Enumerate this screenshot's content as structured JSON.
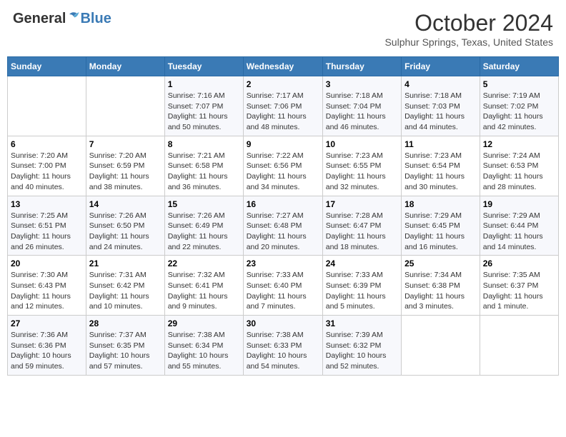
{
  "header": {
    "logo": {
      "general": "General",
      "blue": "Blue"
    },
    "title": "October 2024",
    "location": "Sulphur Springs, Texas, United States"
  },
  "weekdays": [
    "Sunday",
    "Monday",
    "Tuesday",
    "Wednesday",
    "Thursday",
    "Friday",
    "Saturday"
  ],
  "weeks": [
    [
      {
        "day": "",
        "empty": true
      },
      {
        "day": "",
        "empty": true
      },
      {
        "day": "1",
        "sunrise": "Sunrise: 7:16 AM",
        "sunset": "Sunset: 7:07 PM",
        "daylight": "Daylight: 11 hours and 50 minutes."
      },
      {
        "day": "2",
        "sunrise": "Sunrise: 7:17 AM",
        "sunset": "Sunset: 7:06 PM",
        "daylight": "Daylight: 11 hours and 48 minutes."
      },
      {
        "day": "3",
        "sunrise": "Sunrise: 7:18 AM",
        "sunset": "Sunset: 7:04 PM",
        "daylight": "Daylight: 11 hours and 46 minutes."
      },
      {
        "day": "4",
        "sunrise": "Sunrise: 7:18 AM",
        "sunset": "Sunset: 7:03 PM",
        "daylight": "Daylight: 11 hours and 44 minutes."
      },
      {
        "day": "5",
        "sunrise": "Sunrise: 7:19 AM",
        "sunset": "Sunset: 7:02 PM",
        "daylight": "Daylight: 11 hours and 42 minutes."
      }
    ],
    [
      {
        "day": "6",
        "sunrise": "Sunrise: 7:20 AM",
        "sunset": "Sunset: 7:00 PM",
        "daylight": "Daylight: 11 hours and 40 minutes."
      },
      {
        "day": "7",
        "sunrise": "Sunrise: 7:20 AM",
        "sunset": "Sunset: 6:59 PM",
        "daylight": "Daylight: 11 hours and 38 minutes."
      },
      {
        "day": "8",
        "sunrise": "Sunrise: 7:21 AM",
        "sunset": "Sunset: 6:58 PM",
        "daylight": "Daylight: 11 hours and 36 minutes."
      },
      {
        "day": "9",
        "sunrise": "Sunrise: 7:22 AM",
        "sunset": "Sunset: 6:56 PM",
        "daylight": "Daylight: 11 hours and 34 minutes."
      },
      {
        "day": "10",
        "sunrise": "Sunrise: 7:23 AM",
        "sunset": "Sunset: 6:55 PM",
        "daylight": "Daylight: 11 hours and 32 minutes."
      },
      {
        "day": "11",
        "sunrise": "Sunrise: 7:23 AM",
        "sunset": "Sunset: 6:54 PM",
        "daylight": "Daylight: 11 hours and 30 minutes."
      },
      {
        "day": "12",
        "sunrise": "Sunrise: 7:24 AM",
        "sunset": "Sunset: 6:53 PM",
        "daylight": "Daylight: 11 hours and 28 minutes."
      }
    ],
    [
      {
        "day": "13",
        "sunrise": "Sunrise: 7:25 AM",
        "sunset": "Sunset: 6:51 PM",
        "daylight": "Daylight: 11 hours and 26 minutes."
      },
      {
        "day": "14",
        "sunrise": "Sunrise: 7:26 AM",
        "sunset": "Sunset: 6:50 PM",
        "daylight": "Daylight: 11 hours and 24 minutes."
      },
      {
        "day": "15",
        "sunrise": "Sunrise: 7:26 AM",
        "sunset": "Sunset: 6:49 PM",
        "daylight": "Daylight: 11 hours and 22 minutes."
      },
      {
        "day": "16",
        "sunrise": "Sunrise: 7:27 AM",
        "sunset": "Sunset: 6:48 PM",
        "daylight": "Daylight: 11 hours and 20 minutes."
      },
      {
        "day": "17",
        "sunrise": "Sunrise: 7:28 AM",
        "sunset": "Sunset: 6:47 PM",
        "daylight": "Daylight: 11 hours and 18 minutes."
      },
      {
        "day": "18",
        "sunrise": "Sunrise: 7:29 AM",
        "sunset": "Sunset: 6:45 PM",
        "daylight": "Daylight: 11 hours and 16 minutes."
      },
      {
        "day": "19",
        "sunrise": "Sunrise: 7:29 AM",
        "sunset": "Sunset: 6:44 PM",
        "daylight": "Daylight: 11 hours and 14 minutes."
      }
    ],
    [
      {
        "day": "20",
        "sunrise": "Sunrise: 7:30 AM",
        "sunset": "Sunset: 6:43 PM",
        "daylight": "Daylight: 11 hours and 12 minutes."
      },
      {
        "day": "21",
        "sunrise": "Sunrise: 7:31 AM",
        "sunset": "Sunset: 6:42 PM",
        "daylight": "Daylight: 11 hours and 10 minutes."
      },
      {
        "day": "22",
        "sunrise": "Sunrise: 7:32 AM",
        "sunset": "Sunset: 6:41 PM",
        "daylight": "Daylight: 11 hours and 9 minutes."
      },
      {
        "day": "23",
        "sunrise": "Sunrise: 7:33 AM",
        "sunset": "Sunset: 6:40 PM",
        "daylight": "Daylight: 11 hours and 7 minutes."
      },
      {
        "day": "24",
        "sunrise": "Sunrise: 7:33 AM",
        "sunset": "Sunset: 6:39 PM",
        "daylight": "Daylight: 11 hours and 5 minutes."
      },
      {
        "day": "25",
        "sunrise": "Sunrise: 7:34 AM",
        "sunset": "Sunset: 6:38 PM",
        "daylight": "Daylight: 11 hours and 3 minutes."
      },
      {
        "day": "26",
        "sunrise": "Sunrise: 7:35 AM",
        "sunset": "Sunset: 6:37 PM",
        "daylight": "Daylight: 11 hours and 1 minute."
      }
    ],
    [
      {
        "day": "27",
        "sunrise": "Sunrise: 7:36 AM",
        "sunset": "Sunset: 6:36 PM",
        "daylight": "Daylight: 10 hours and 59 minutes."
      },
      {
        "day": "28",
        "sunrise": "Sunrise: 7:37 AM",
        "sunset": "Sunset: 6:35 PM",
        "daylight": "Daylight: 10 hours and 57 minutes."
      },
      {
        "day": "29",
        "sunrise": "Sunrise: 7:38 AM",
        "sunset": "Sunset: 6:34 PM",
        "daylight": "Daylight: 10 hours and 55 minutes."
      },
      {
        "day": "30",
        "sunrise": "Sunrise: 7:38 AM",
        "sunset": "Sunset: 6:33 PM",
        "daylight": "Daylight: 10 hours and 54 minutes."
      },
      {
        "day": "31",
        "sunrise": "Sunrise: 7:39 AM",
        "sunset": "Sunset: 6:32 PM",
        "daylight": "Daylight: 10 hours and 52 minutes."
      },
      {
        "day": "",
        "empty": true
      },
      {
        "day": "",
        "empty": true
      }
    ]
  ]
}
